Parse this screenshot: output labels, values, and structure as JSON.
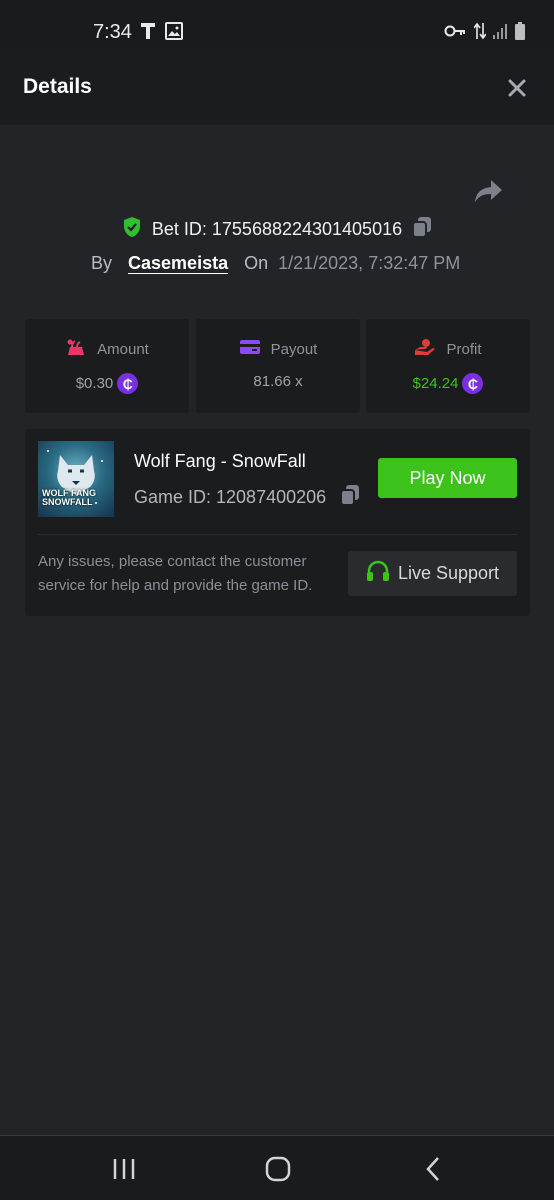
{
  "status_bar": {
    "time": "7:34",
    "left_icons": [
      "t-icon",
      "image-icon"
    ],
    "right_icons": [
      "key-icon",
      "data-arrows-icon",
      "signal-icon",
      "battery-icon"
    ]
  },
  "header": {
    "title": "Details",
    "close_icon": "close-icon"
  },
  "bet": {
    "id_label": "Bet ID: 1755688224301405016",
    "by_label": "By",
    "username": "Casemeista",
    "on_label": "On",
    "date": "1/21/2023, 7:32:47 PM"
  },
  "stats": {
    "amount": {
      "label": "Amount",
      "value": "$0.30",
      "color": "#e8386a"
    },
    "payout": {
      "label": "Payout",
      "value": "81.66 x",
      "color": "#8a4af3"
    },
    "profit": {
      "label": "Profit",
      "value": "$24.24",
      "color": "#e03a3a",
      "value_color": "#3dc21c"
    },
    "coin_symbol": "₵"
  },
  "game": {
    "title": "Wolf Fang - SnowFall",
    "id_label": "Game ID: 12087400206",
    "thumb_text": "WOLF FANG SNOWFALL",
    "play_label": "Play Now",
    "support_text": "Any issues, please contact the customer service for help and provide the game ID.",
    "support_label": "Live Support"
  },
  "colors": {
    "accent_green": "#3dc21c",
    "background": "#232427",
    "card": "#1b1c1e"
  }
}
